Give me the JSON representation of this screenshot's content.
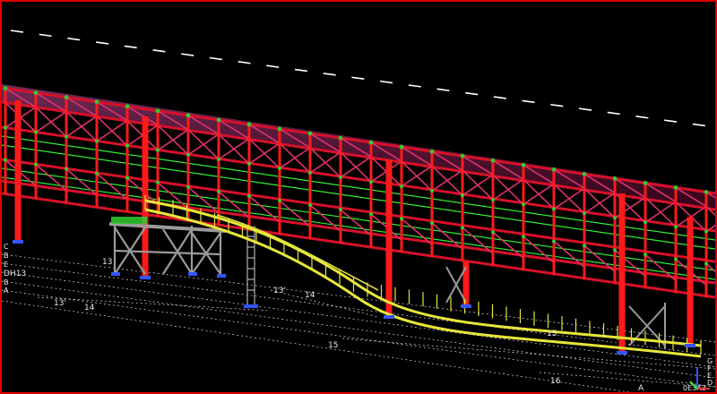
{
  "viewport": {
    "background": "#000000",
    "frame_color": "#e00000",
    "colors": {
      "columns": "#ff1a1a",
      "truss": "#d8102a",
      "bracing": "#e0306e",
      "purlins": "#ff66cc",
      "handrail": "#33ee33",
      "walkway": "#e6e63a",
      "grey_steel": "#9a9a9a",
      "base_plates": "#3355ff",
      "connections": "#2fcc2f",
      "gridlines": "#ffffff"
    }
  },
  "grid_labels": {
    "left_stack": [
      "C",
      "B",
      "E",
      "DH13",
      "B",
      "A"
    ],
    "g13_left": "13",
    "g13_prime_mid": "13'",
    "g14_mid": "14",
    "g13_prime_low": "13'",
    "g14_low": "14",
    "g15": "15",
    "g15_right": "15",
    "g16": "16",
    "a_bottom": "A",
    "bottom_right": "0E3A3",
    "right_stack": [
      "G",
      "F",
      "E",
      "D"
    ]
  },
  "axis_gizmo": {
    "icon": "ucs-axis-icon"
  }
}
